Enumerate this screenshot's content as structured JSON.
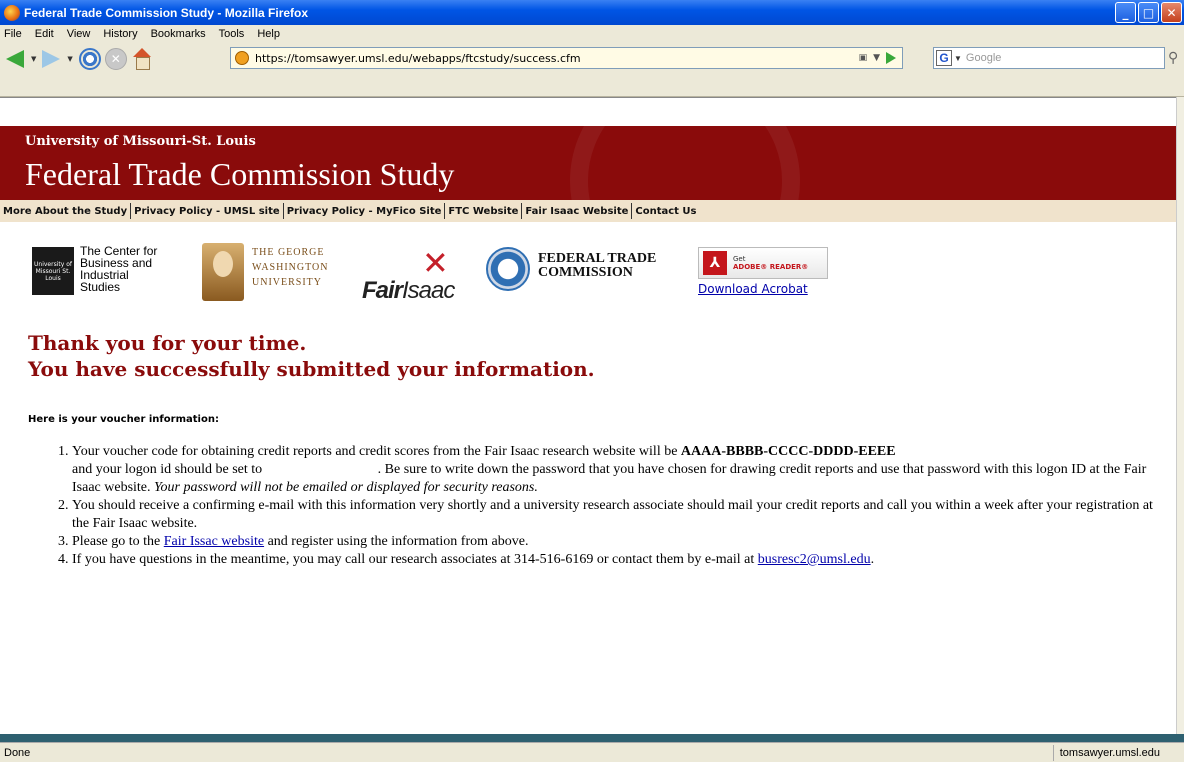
{
  "window": {
    "title": "Federal Trade Commission Study - Mozilla Firefox"
  },
  "menu": [
    "File",
    "Edit",
    "View",
    "History",
    "Bookmarks",
    "Tools",
    "Help"
  ],
  "nav": {
    "url": "https://tomsawyer.umsl.edu/webapps/ftcstudy/success.cfm",
    "search_placeholder": "Google"
  },
  "banner": {
    "university": "University of Missouri-St. Louis",
    "title": "Federal Trade Commission Study"
  },
  "links": [
    "More About the Study",
    "Privacy Policy - UMSL site",
    "Privacy Policy - MyFico Site",
    "FTC Website",
    "Fair Isaac Website",
    "Contact Us"
  ],
  "logos": {
    "cbis": "The Center for Business and Industrial Studies",
    "cbis_lines": [
      "The Center for",
      "Business and",
      "Industrial",
      "Studies"
    ],
    "cbis_mark": "University of Missouri St. Louis",
    "gw_lines": [
      "THE GEORGE",
      "WASHINGTON",
      "UNIVERSITY"
    ],
    "fairisaac_a": "Fair",
    "fairisaac_b": "Isaac",
    "ftc_lines": [
      "FEDERAL TRADE",
      "COMMISSION"
    ],
    "adobe_get": "Get",
    "adobe_reader": "ADOBE® READER®",
    "download": "Download Acrobat"
  },
  "thanks": {
    "line1": "Thank you for your time.",
    "line2": "You have successfully submitted your information."
  },
  "voucher_heading": "Here is your voucher information:",
  "items": {
    "i1_a": "Your voucher code for obtaining credit reports and credit scores from the Fair Isaac research website will be ",
    "i1_code": "AAAA-BBBB-CCCC-DDDD-EEEE",
    "i1_b": "and your logon id should be set to ",
    "i1_c": ". Be sure to write down the password that you have chosen for drawing credit reports and use that password with this logon ID at the Fair Isaac website. ",
    "i1_em": "Your password will not be emailed or displayed for security reasons.",
    "i2": "You should receive a confirming e-mail with this information very shortly and a university research associate should mail your credit reports and call you within a week after your registration at the Fair Isaac website.",
    "i3_a": "Please go to the ",
    "i3_link": "Fair Issac website",
    "i3_b": " and register using the information from above.",
    "i4_a": "If you have questions in the meantime, you may call our research associates at 314-516-6169 or contact them by e-mail at ",
    "i4_link": "busresc2@umsl.edu",
    "i4_b": "."
  },
  "status": {
    "left": "Done",
    "host": "tomsawyer.umsl.edu"
  }
}
